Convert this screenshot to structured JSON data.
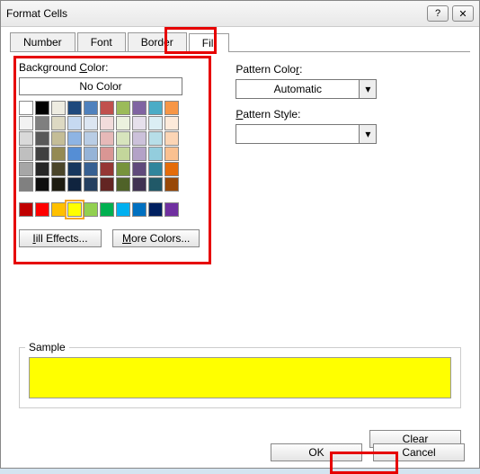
{
  "title": "Format Cells",
  "titlebar": {
    "help_glyph": "?",
    "close_glyph": "✕"
  },
  "tabs": [
    {
      "label": "Number"
    },
    {
      "label": "Font"
    },
    {
      "label": "Border"
    },
    {
      "label": "Fill",
      "active": true
    }
  ],
  "fill": {
    "bg_label_pre": "Background ",
    "bg_label_u": "C",
    "bg_label_post": "olor:",
    "no_color": "No Color",
    "fill_effects": "Fill Effects...",
    "more_colors": "More Colors...",
    "theme_colors": [
      [
        "#ffffff",
        "#000000",
        "#eeece1",
        "#1f497d",
        "#4f81bd",
        "#c0504d",
        "#9bbb59",
        "#8064a2",
        "#4bacc6",
        "#f79646"
      ],
      [
        "#f2f2f2",
        "#7f7f7f",
        "#ddd9c3",
        "#c6d9f1",
        "#dce6f2",
        "#f2dcdb",
        "#ebf1de",
        "#e6e0ec",
        "#dbeef4",
        "#fdeada"
      ],
      [
        "#d9d9d9",
        "#595959",
        "#c4bd97",
        "#8eb4e3",
        "#b9cde5",
        "#e6b9b8",
        "#d7e4bd",
        "#ccc1da",
        "#b7dee8",
        "#fcd5b5"
      ],
      [
        "#bfbfbf",
        "#404040",
        "#948a54",
        "#558ed5",
        "#95b3d7",
        "#d99694",
        "#c3d69b",
        "#b3a2c7",
        "#93cddd",
        "#fac090"
      ],
      [
        "#a6a6a6",
        "#262626",
        "#4a452a",
        "#17375e",
        "#376092",
        "#953735",
        "#77933c",
        "#604a7b",
        "#31859c",
        "#e46c0a"
      ],
      [
        "#808080",
        "#0d0d0d",
        "#1e1c11",
        "#10243f",
        "#254061",
        "#632523",
        "#4f6228",
        "#403152",
        "#215968",
        "#984807"
      ]
    ],
    "standard_colors": [
      "#c00000",
      "#ff0000",
      "#ffc000",
      "#ffff00",
      "#92d050",
      "#00b050",
      "#00b0f0",
      "#0070c0",
      "#002060",
      "#7030a0"
    ],
    "selected_color": "#ffff00"
  },
  "pattern": {
    "color_label_pre": "Pattern Colo",
    "color_label_u": "r",
    "color_label_post": ":",
    "color_value": "Automatic",
    "style_label_pre": "",
    "style_label_u": "P",
    "style_label_post": "attern Style:",
    "arrow": "▾"
  },
  "sample": {
    "label": "Sample",
    "color": "#ffff00"
  },
  "buttons": {
    "clear": "Clear",
    "ok": "OK",
    "cancel": "Cancel"
  }
}
